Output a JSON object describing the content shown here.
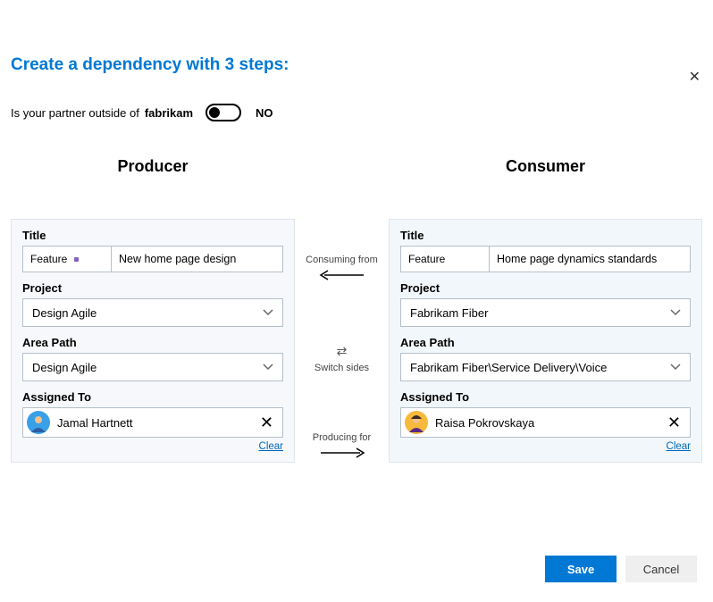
{
  "close_icon_name": "close-icon",
  "heading": "Create a dependency with 3 steps:",
  "partner_question_prefix": "Is your partner outside of ",
  "partner_org": "fabrikam",
  "toggle_state": "NO",
  "producer": {
    "heading": "Producer",
    "title_label": "Title",
    "title_type": "Feature",
    "title_value": "New home page design",
    "project_label": "Project",
    "project_value": "Design Agile",
    "area_label": "Area Path",
    "area_value": "Design Agile",
    "assigned_label": "Assigned To",
    "assignee": "Jamal Hartnett",
    "clear": "Clear"
  },
  "consumer": {
    "heading": "Consumer",
    "title_label": "Title",
    "title_type": "Feature",
    "title_value": "Home page dynamics standards",
    "project_label": "Project",
    "project_value": "Fabrikam Fiber",
    "area_label": "Area Path",
    "area_value": "Fabrikam Fiber\\Service Delivery\\Voice",
    "assigned_label": "Assigned To",
    "assignee": "Raisa Pokrovskaya",
    "clear": "Clear"
  },
  "mid": {
    "consuming_from": "Consuming from",
    "switch_sides": "Switch sides",
    "producing_for": "Producing for"
  },
  "footer": {
    "save": "Save",
    "cancel": "Cancel"
  }
}
